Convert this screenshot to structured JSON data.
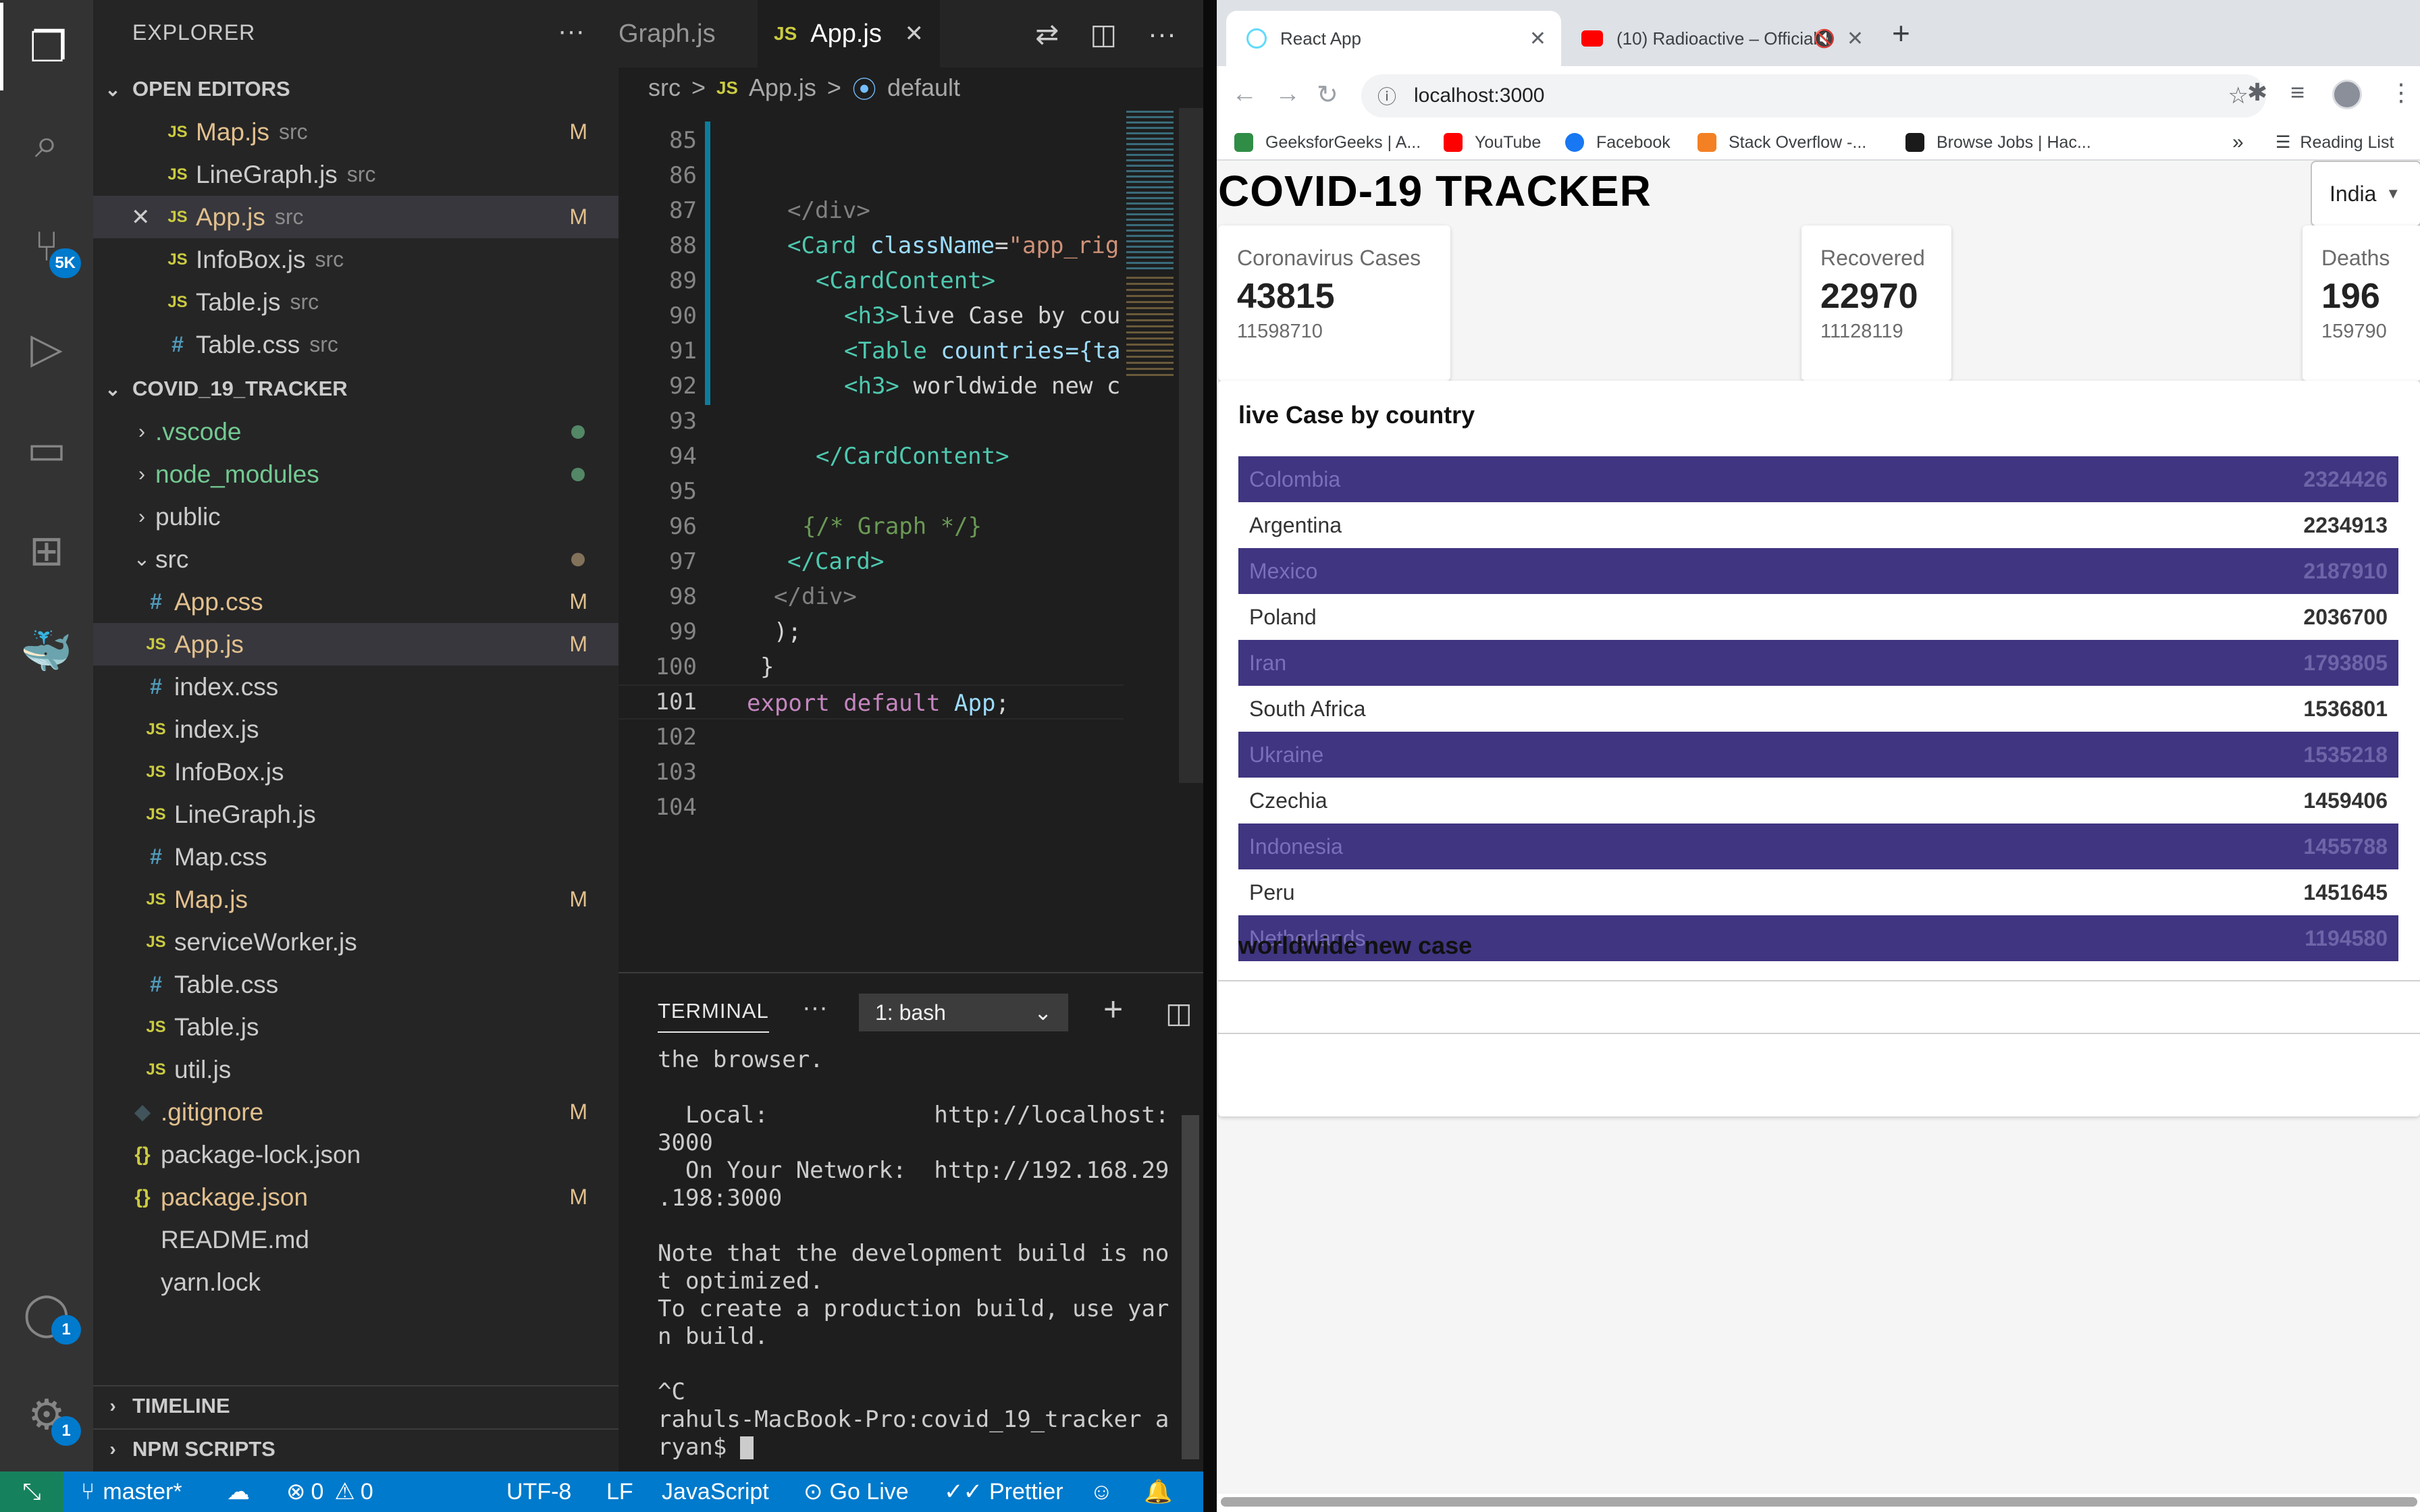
{
  "vscode": {
    "explorer_title": "EXPLORER",
    "more": "···",
    "open_editors": {
      "title": "OPEN EDITORS",
      "items": [
        {
          "icon": "JS",
          "name": "Map.js",
          "dir": "src",
          "status": "M"
        },
        {
          "icon": "JS",
          "name": "LineGraph.js",
          "dir": "src",
          "status": ""
        },
        {
          "icon": "JS",
          "name": "App.js",
          "dir": "src",
          "status": "M"
        },
        {
          "icon": "JS",
          "name": "InfoBox.js",
          "dir": "src",
          "status": ""
        },
        {
          "icon": "JS",
          "name": "Table.js",
          "dir": "src",
          "status": ""
        },
        {
          "icon": "#",
          "name": "Table.css",
          "dir": "src",
          "status": ""
        }
      ]
    },
    "project": {
      "title": "COVID_19_TRACKER",
      "items": [
        {
          "name": ".vscode",
          "type": "folder"
        },
        {
          "name": "node_modules",
          "type": "folder"
        },
        {
          "name": "public",
          "type": "folder"
        },
        {
          "name": "src",
          "type": "folder-open"
        },
        {
          "name": "App.css",
          "icon": "#",
          "status": "M"
        },
        {
          "name": "App.js",
          "icon": "JS",
          "status": "M"
        },
        {
          "name": "index.css",
          "icon": "#",
          "status": ""
        },
        {
          "name": "index.js",
          "icon": "JS",
          "status": ""
        },
        {
          "name": "InfoBox.js",
          "icon": "JS",
          "status": ""
        },
        {
          "name": "LineGraph.js",
          "icon": "JS",
          "status": ""
        },
        {
          "name": "Map.css",
          "icon": "#",
          "status": ""
        },
        {
          "name": "Map.js",
          "icon": "JS",
          "status": "M"
        },
        {
          "name": "serviceWorker.js",
          "icon": "JS",
          "status": ""
        },
        {
          "name": "Table.css",
          "icon": "#",
          "status": ""
        },
        {
          "name": "Table.js",
          "icon": "JS",
          "status": ""
        },
        {
          "name": "util.js",
          "icon": "JS",
          "status": ""
        },
        {
          "name": ".gitignore",
          "icon": "◆",
          "status": "M"
        },
        {
          "name": "package-lock.json",
          "icon": "{}",
          "status": ""
        },
        {
          "name": "package.json",
          "icon": "{}",
          "status": "M"
        },
        {
          "name": "README.md",
          "icon": "",
          "status": ""
        },
        {
          "name": "yarn.lock",
          "icon": "",
          "status": ""
        }
      ]
    },
    "timeline": "TIMELINE",
    "npm_scripts": "NPM SCRIPTS",
    "badges": {
      "source_control": "5K",
      "accounts": "1",
      "settings": "1"
    },
    "tabs": {
      "prev": "Graph.js",
      "active": "App.js",
      "js_icon": "JS",
      "close": "✕"
    },
    "breadcrumb": {
      "folder": "src",
      "sep": ">",
      "file": "App.js",
      "symbol": "default"
    },
    "code_lines": [
      {
        "n": "85"
      },
      {
        "n": "86"
      },
      {
        "n": "87"
      },
      {
        "n": "88"
      },
      {
        "n": "89"
      },
      {
        "n": "90"
      },
      {
        "n": "91"
      },
      {
        "n": "92"
      },
      {
        "n": "93"
      },
      {
        "n": "94"
      },
      {
        "n": "95"
      },
      {
        "n": "96"
      },
      {
        "n": "97"
      },
      {
        "n": "98"
      },
      {
        "n": "99"
      },
      {
        "n": "100"
      },
      {
        "n": "101"
      },
      {
        "n": "102"
      },
      {
        "n": "103"
      },
      {
        "n": "104"
      }
    ],
    "code": {
      "l87": "</div>",
      "l88a": "<Card ",
      "l88b": "className",
      "l88c": "=",
      "l88d": "\"app_rig",
      "l89": "<CardContent>",
      "l90a": "<h3>",
      "l90b": "live Case by cou",
      "l91a": "<Table ",
      "l91b": "countries",
      "l91c": "={ta",
      "l92a": "<h3>",
      "l92b": " worldwide new c",
      "l94": "</CardContent>",
      "l96": "{/* Graph */}",
      "l97": "</Card>",
      "l98": "</div>",
      "l99": ");",
      "l100": "}",
      "l101a": "export default ",
      "l101b": "App",
      "l101c": ";"
    },
    "terminal": {
      "tab": "TERMINAL",
      "shell": "1: bash",
      "lines": [
        "the browser.",
        "",
        "  Local:            http://localhost:",
        "3000",
        "  On Your Network:  http://192.168.29",
        ".198:3000",
        "",
        "Note that the development build is no",
        "t optimized.",
        "To create a production build, use yar",
        "n build.",
        "",
        "^C",
        "rahuls-MacBook-Pro:covid_19_tracker a",
        "ryan$ "
      ]
    },
    "status": {
      "branch": "master*",
      "errors": "0",
      "warnings": "0",
      "encoding": "UTF-8",
      "eol": "LF",
      "language": "JavaScript",
      "golive": "Go Live",
      "prettier": "Prettier"
    }
  },
  "chrome": {
    "tabs": [
      {
        "title": "React App",
        "active": true
      },
      {
        "title": "(10) Radioactive – Official I",
        "active": false
      }
    ],
    "url": "localhost:3000",
    "bookmarks": [
      "GeeksforGeeks | A...",
      "YouTube",
      "Facebook",
      "Stack Overflow -...",
      "Browse Jobs | Hac..."
    ],
    "reading_list": "Reading List",
    "more_bookmarks": "»"
  },
  "app": {
    "title": "COVID-19 TRACKER",
    "country": "India",
    "infoboxes": [
      {
        "title": "Coronavirus Cases",
        "cases": "43815",
        "total": "11598710"
      },
      {
        "title": "Recovered",
        "cases": "22970",
        "total": "11128119"
      },
      {
        "title": "Deaths",
        "cases": "196",
        "total": "159790"
      }
    ],
    "table_title": "live Case by country",
    "graph_title": "worldwide new case",
    "countries": [
      {
        "name": "Colombia",
        "cases": "2324426"
      },
      {
        "name": "Argentina",
        "cases": "2234913"
      },
      {
        "name": "Mexico",
        "cases": "2187910"
      },
      {
        "name": "Poland",
        "cases": "2036700"
      },
      {
        "name": "Iran",
        "cases": "1793805"
      },
      {
        "name": "South Africa",
        "cases": "1536801"
      },
      {
        "name": "Ukraine",
        "cases": "1535218"
      },
      {
        "name": "Czechia",
        "cases": "1459406"
      },
      {
        "name": "Indonesia",
        "cases": "1455788"
      },
      {
        "name": "Peru",
        "cases": "1451645"
      },
      {
        "name": "Netherlands",
        "cases": "1194580"
      }
    ]
  }
}
